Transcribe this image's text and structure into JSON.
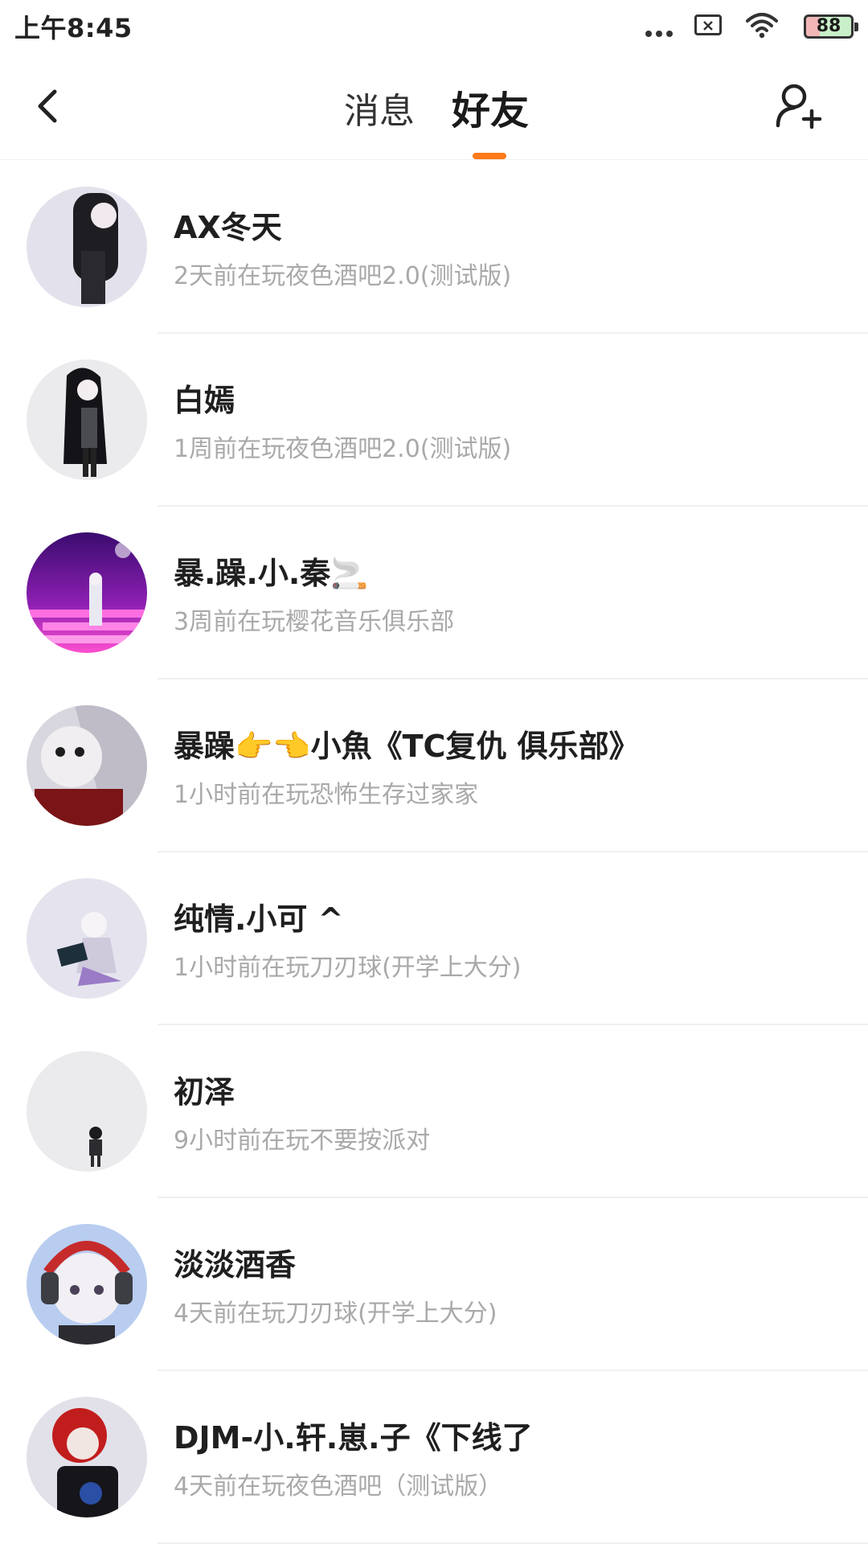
{
  "status_bar": {
    "time": "上午8:45",
    "battery_level": "88",
    "icons": [
      "more-dots-icon",
      "sim-blocked-icon",
      "wifi-icon",
      "battery-icon"
    ]
  },
  "header": {
    "back_icon": "chevron-left-icon",
    "tabs": [
      {
        "label": "消息",
        "active": false
      },
      {
        "label": "好友",
        "active": true
      }
    ],
    "add_friend_icon": "add-person-icon",
    "accent_color": "#ff7a1a"
  },
  "friends": [
    {
      "name": "AX冬天",
      "status": "2天前在玩夜色酒吧2.0(测试版)",
      "avatar_bg": "#e3e2ec"
    },
    {
      "name": "白嫣",
      "status": "1周前在玩夜色酒吧2.0(测试版)",
      "avatar_bg": "#ebebee"
    },
    {
      "name": "暴.躁.小.秦🚬",
      "status": "3周前在玩樱花音乐俱乐部",
      "avatar_bg": "#7a1ea8"
    },
    {
      "name": "暴躁👉👈小魚《TC复仇 俱乐部》",
      "status": "1小时前在玩恐怖生存过家家",
      "avatar_bg": "#d8d6de"
    },
    {
      "name": "纯情.小可 ^",
      "status": "1小时前在玩刀刃球(开学上大分)",
      "avatar_bg": "#e5e4ee"
    },
    {
      "name": "初泽",
      "status": "9小时前在玩不要按派对",
      "avatar_bg": "#ebebee"
    },
    {
      "name": "淡淡酒香",
      "status": "4天前在玩刀刃球(开学上大分)",
      "avatar_bg": "#b8cdf0"
    },
    {
      "name": "DJM-小.轩.崽.子《下线了",
      "status": "4天前在玩夜色酒吧（测试版）",
      "avatar_bg": "#e2e1ea"
    }
  ]
}
